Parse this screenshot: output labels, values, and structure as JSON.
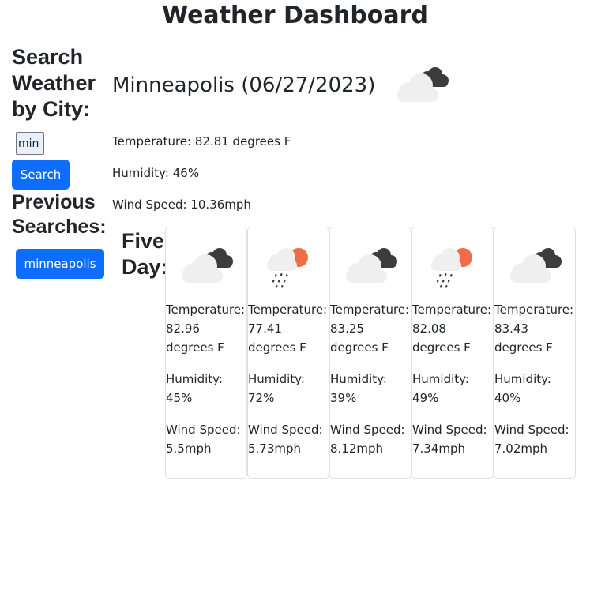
{
  "header": {
    "title": "Weather Dashboard"
  },
  "sidebar": {
    "search_heading": "Search\nWeather\nby City:",
    "search_value": "min",
    "search_button": "Search",
    "previous_heading": "Previous\nSearches:",
    "history": [
      "minneapolis"
    ]
  },
  "current": {
    "title": "Minneapolis (06/27/2023)",
    "icon": "cloudy-icon",
    "temperature": "Temperature: 82.81 degrees F",
    "humidity": "Humidity: 46%",
    "wind": "Wind Speed: 10.36mph"
  },
  "forecast": {
    "heading": "Five\nDay:",
    "days": [
      {
        "icon": "cloudy-icon",
        "temperature": "Temperature: 82.96 degrees F",
        "humidity": "Humidity: 45%",
        "wind": "Wind Speed: 5.5mph"
      },
      {
        "icon": "rain-sun-icon",
        "temperature": "Temperature: 77.41 degrees F",
        "humidity": "Humidity: 72%",
        "wind": "Wind Speed: 5.73mph"
      },
      {
        "icon": "cloudy-icon",
        "temperature": "Temperature: 83.25 degrees F",
        "humidity": "Humidity: 39%",
        "wind": "Wind Speed: 8.12mph"
      },
      {
        "icon": "rain-sun-icon",
        "temperature": "Temperature: 82.08 degrees F",
        "humidity": "Humidity: 49%",
        "wind": "Wind Speed: 7.34mph"
      },
      {
        "icon": "cloudy-icon",
        "temperature": "Temperature: 83.43 degrees F",
        "humidity": "Humidity: 40%",
        "wind": "Wind Speed: 7.02mph"
      }
    ]
  },
  "colors": {
    "accent": "#0d6efd",
    "sun": "#ef6c47",
    "dark_cloud": "#3c3c3c",
    "light_cloud": "#efefef"
  }
}
